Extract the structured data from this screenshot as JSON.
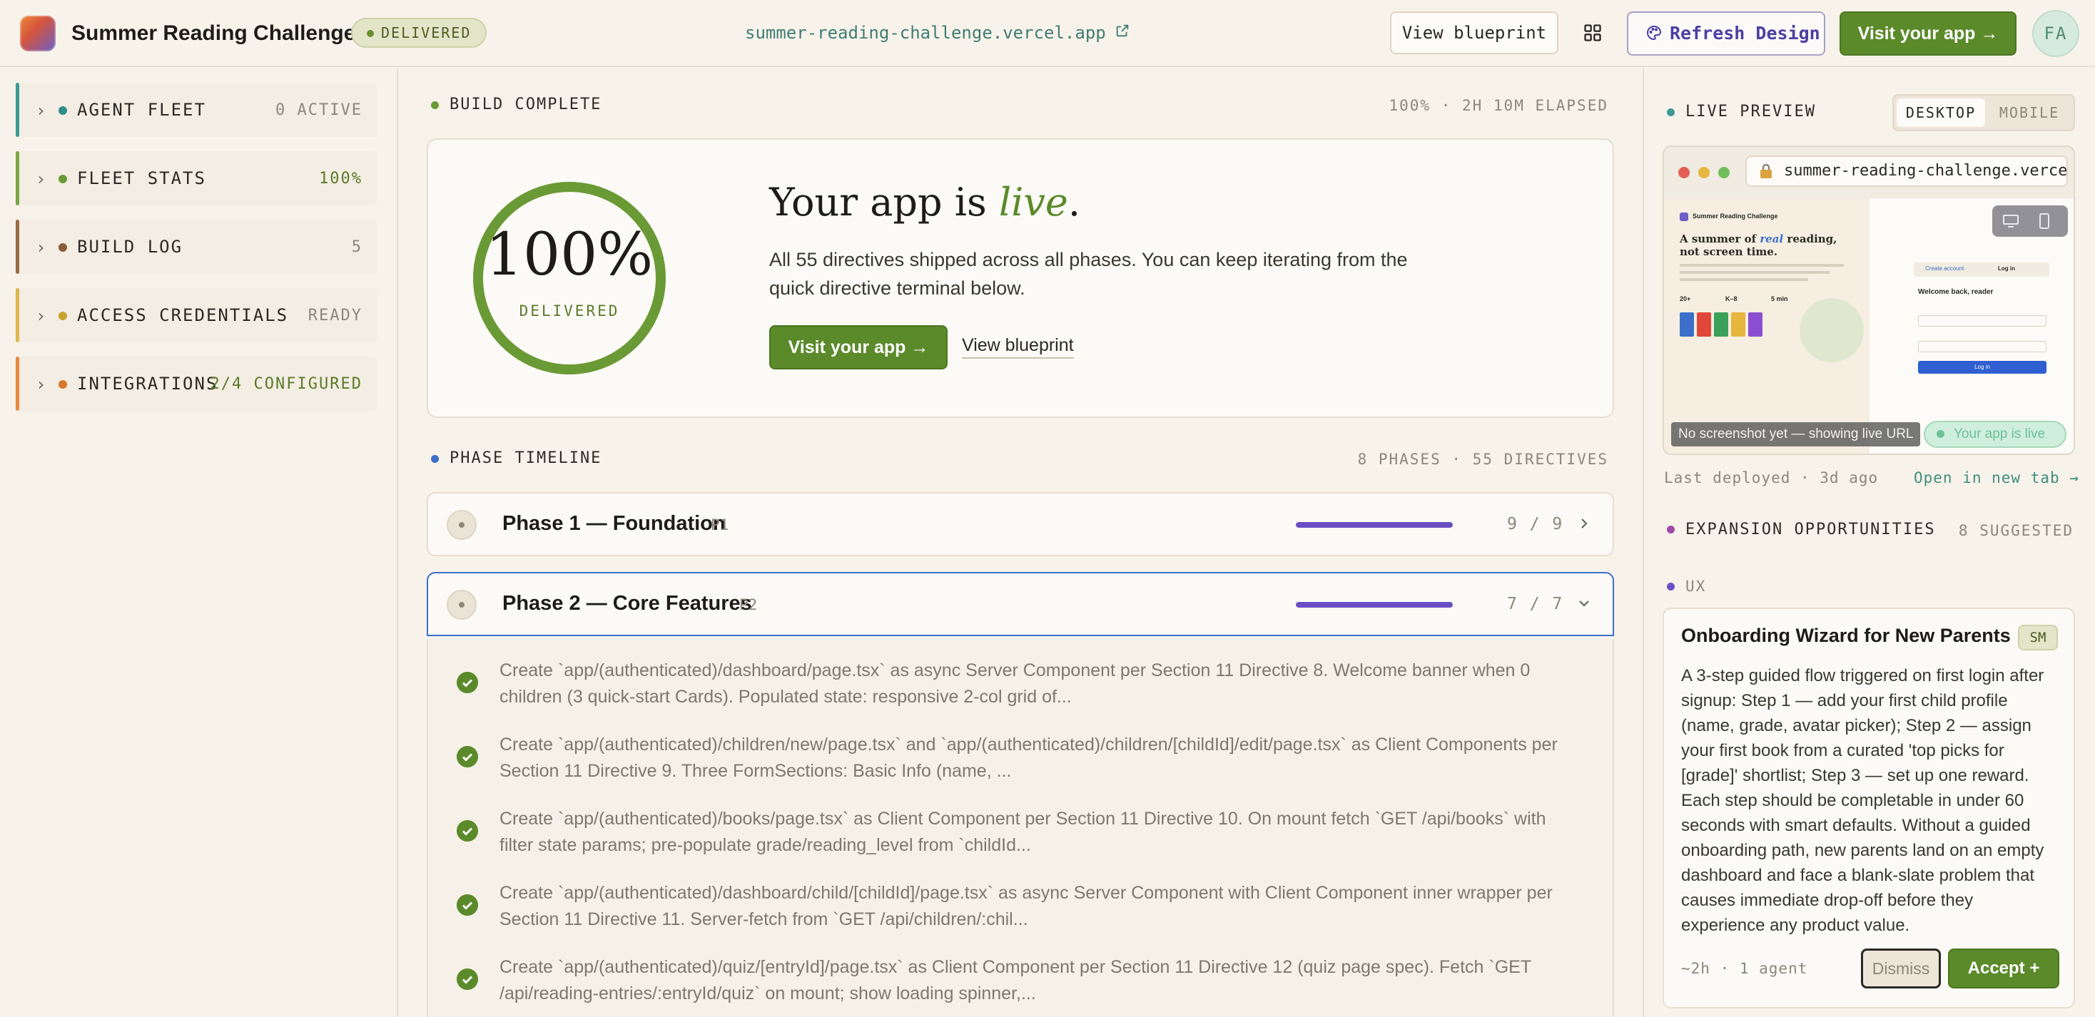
{
  "header": {
    "app_title": "Summer Reading Challenge",
    "status_badge": "DELIVERED",
    "app_url": "summer-reading-challenge.vercel.app",
    "view_blueprint": "View blueprint",
    "refresh_design": "Refresh Design",
    "visit_app": "Visit your app →",
    "avatar_initials": "FA"
  },
  "sidebar": {
    "items": [
      {
        "label": "AGENT FLEET",
        "value": "0 ACTIVE",
        "bar_color": "#3b9a94",
        "dot_color": "#2f8f88",
        "value_color": "#8c867b"
      },
      {
        "label": "FLEET STATS",
        "value": "100%",
        "bar_color": "#7aa64a",
        "dot_color": "#6a9a36",
        "value_color": "#5b7a2a"
      },
      {
        "label": "BUILD LOG",
        "value": "5",
        "bar_color": "#9a6a44",
        "dot_color": "#8a5a34",
        "value_color": "#8c867b"
      },
      {
        "label": "ACCESS CREDENTIALS",
        "value": "READY",
        "bar_color": "#e0b84a",
        "dot_color": "#c9a12e",
        "value_color": "#8c867b"
      },
      {
        "label": "INTEGRATIONS",
        "value": "2/4 CONFIGURED",
        "bar_color": "#e88a3e",
        "dot_color": "#d9782a",
        "value_color": "#5b7a2a"
      }
    ]
  },
  "build": {
    "section_label": "BUILD COMPLETE",
    "section_meta": "100% · 2H 10M ELAPSED",
    "percent_text": "100%",
    "progress": 1.0,
    "ring_label": "DELIVERED",
    "title_prefix": "Your app is ",
    "title_emph": "live",
    "title_suffix": ".",
    "description": "All 55 directives shipped across all phases. You can keep iterating from the quick directive terminal below.",
    "visit_button": "Visit your app →",
    "view_blueprint": "View blueprint"
  },
  "timeline": {
    "section_label": "PHASE TIMELINE",
    "section_meta": "8 PHASES · 55 DIRECTIVES",
    "phases": [
      {
        "title": "Phase 1 — Foundation",
        "tag": "P1",
        "count": "9 / 9",
        "progress": 1.0
      },
      {
        "title": "Phase 2 — Core Features",
        "tag": "P2",
        "count": "7 / 7",
        "progress": 1.0
      }
    ],
    "directives": [
      "Create `app/(authenticated)/dashboard/page.tsx` as async Server Component per Section 11 Directive 8. Welcome banner when 0 children (3 quick-start Cards). Populated state: responsive 2-col grid of...",
      "Create `app/(authenticated)/children/new/page.tsx` and `app/(authenticated)/children/[childId]/edit/page.tsx` as Client Components per Section 11 Directive 9. Three FormSections: Basic Info (name, ...",
      "Create `app/(authenticated)/books/page.tsx` as Client Component per Section 11 Directive 10. On mount fetch `GET /api/books` with filter state params; pre-populate grade/reading_level from `childId...",
      "Create `app/(authenticated)/dashboard/child/[childId]/page.tsx` as async Server Component with Client Component inner wrapper per Section 11 Directive 11. Server-fetch from `GET /api/children/:chil...",
      "Create `app/(authenticated)/quiz/[entryId]/page.tsx` as Client Component per Section 11 Directive 12 (quiz page spec). Fetch `GET /api/reading-entries/:entryId/quiz` on mount; show loading spinner,..."
    ]
  },
  "preview": {
    "section_label": "LIVE PREVIEW",
    "toggle_desktop": "DESKTOP",
    "toggle_mobile": "MOBILE",
    "address": "summer-reading-challenge.vercel",
    "no_screenshot": "No screenshot yet — showing live URL",
    "live_pill": "Your app is live",
    "last_deployed": "Last deployed · 3d ago",
    "open_tab": "Open in new tab →",
    "mini": {
      "brand": "Summer Reading Challenge",
      "headline_1": "A summer of ",
      "headline_em": "real",
      "headline_2": " reading,",
      "headline_3": "not screen time.",
      "stat_1": "20+",
      "stat_2": "K–8",
      "stat_3": "5 min",
      "tab_1": "Create account",
      "tab_2": "Log in",
      "welcome": "Welcome back, reader",
      "login_button": "Log in"
    }
  },
  "expansion": {
    "section_label": "EXPANSION OPPORTUNITIES",
    "section_meta": "8 SUGGESTED",
    "category": "UX",
    "card": {
      "title": "Onboarding Wizard for New Parents",
      "size": "SM",
      "description": "A 3-step guided flow triggered on first login after signup: Step 1 — add your first child profile (name, grade, avatar picker); Step 2 — assign your first book from a curated 'top picks for [grade]' shortlist; Step 3 — set up one reward. Each step should be completable in under 60 seconds with smart defaults. Without a guided onboarding path, new parents land on an empty dashboard and face a blank-slate problem that causes immediate drop-off before they experience any product value.",
      "meta": "~2h · 1 agent",
      "dismiss": "Dismiss",
      "accept": "Accept +"
    }
  },
  "colors": {
    "accent_green": "#5b8a2a",
    "accent_purple": "#6a4fc4",
    "active_blue": "#3b6fc9",
    "teal_link": "#3f7c74"
  }
}
